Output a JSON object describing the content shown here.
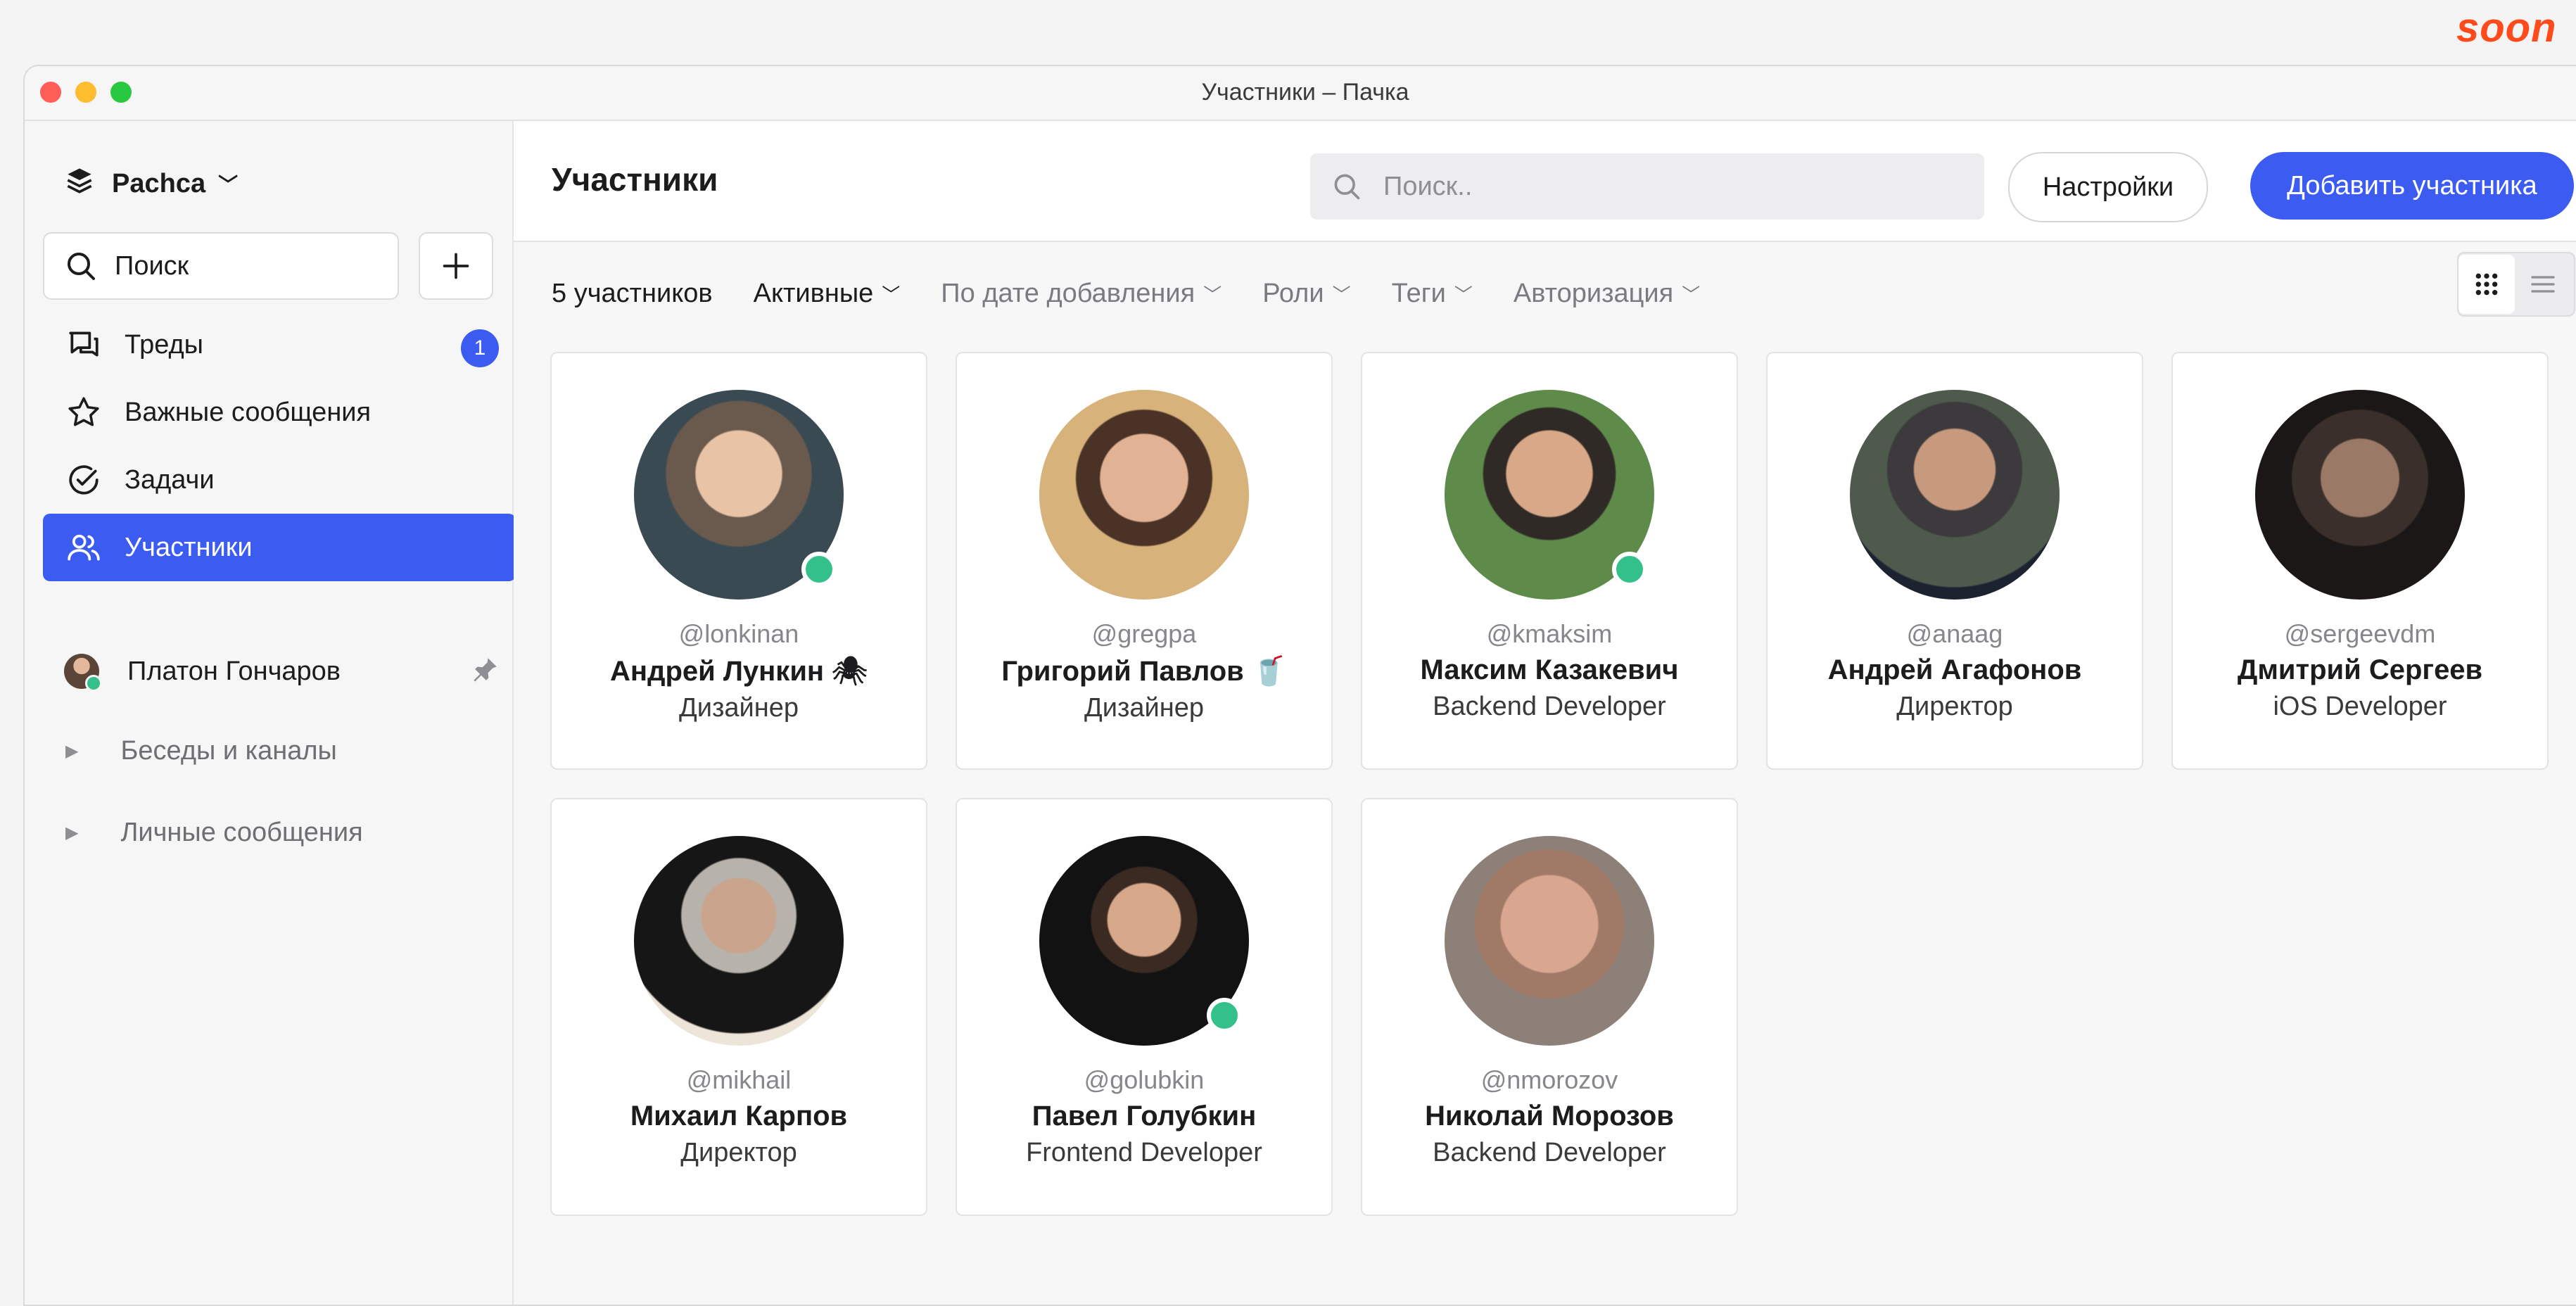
{
  "corner_brand": "soon",
  "window": {
    "title": "Участники – Пачка"
  },
  "sidebar": {
    "workspace": "Pachca",
    "search_label": "Поиск",
    "nav": [
      {
        "label": "Треды",
        "badge": "1",
        "icon": "threads-icon"
      },
      {
        "label": "Важные сообщения",
        "icon": "star-icon"
      },
      {
        "label": "Задачи",
        "icon": "check-circle-icon"
      },
      {
        "label": "Участники",
        "icon": "users-icon",
        "active": true
      }
    ],
    "user": {
      "name": "Платон Гончаров"
    },
    "sections": [
      "Беседы и каналы",
      "Личные сообщения"
    ]
  },
  "header": {
    "title": "Участники",
    "search_placeholder": "Поиск..",
    "settings_label": "Настройки",
    "add_label": "Добавить участника"
  },
  "filters": {
    "count": "5 участников",
    "items": [
      "Активные",
      "По дате добавления",
      "Роли",
      "Теги",
      "Авторизация"
    ]
  },
  "colors": {
    "accent": "#3c5cf1",
    "online": "#33c08b"
  },
  "members": [
    {
      "handle": "@lonkinan",
      "name": "Андрей Лункин 🕷",
      "role": "Дизайнер",
      "online": true
    },
    {
      "handle": "@gregpa",
      "name": "Григорий Павлов 🥤",
      "role": "Дизайнер",
      "online": false
    },
    {
      "handle": "@kmaksim",
      "name": "Максим Казакевич",
      "role": "Backend Developer",
      "online": true
    },
    {
      "handle": "@anaag",
      "name": "Андрей Агафонов",
      "role": "Директор",
      "online": false
    },
    {
      "handle": "@sergeevdm",
      "name": "Дмитрий Сергеев",
      "role": "iOS Developer",
      "online": false
    },
    {
      "handle": "@mikhail",
      "name": "Михаил Карпов",
      "role": "Директор",
      "online": false
    },
    {
      "handle": "@golubkin",
      "name": "Павел Голубкин",
      "role": "Frontend Developer",
      "online": true
    },
    {
      "handle": "@nmorozov",
      "name": "Николай Морозов",
      "role": "Backend Developer",
      "online": false
    }
  ]
}
